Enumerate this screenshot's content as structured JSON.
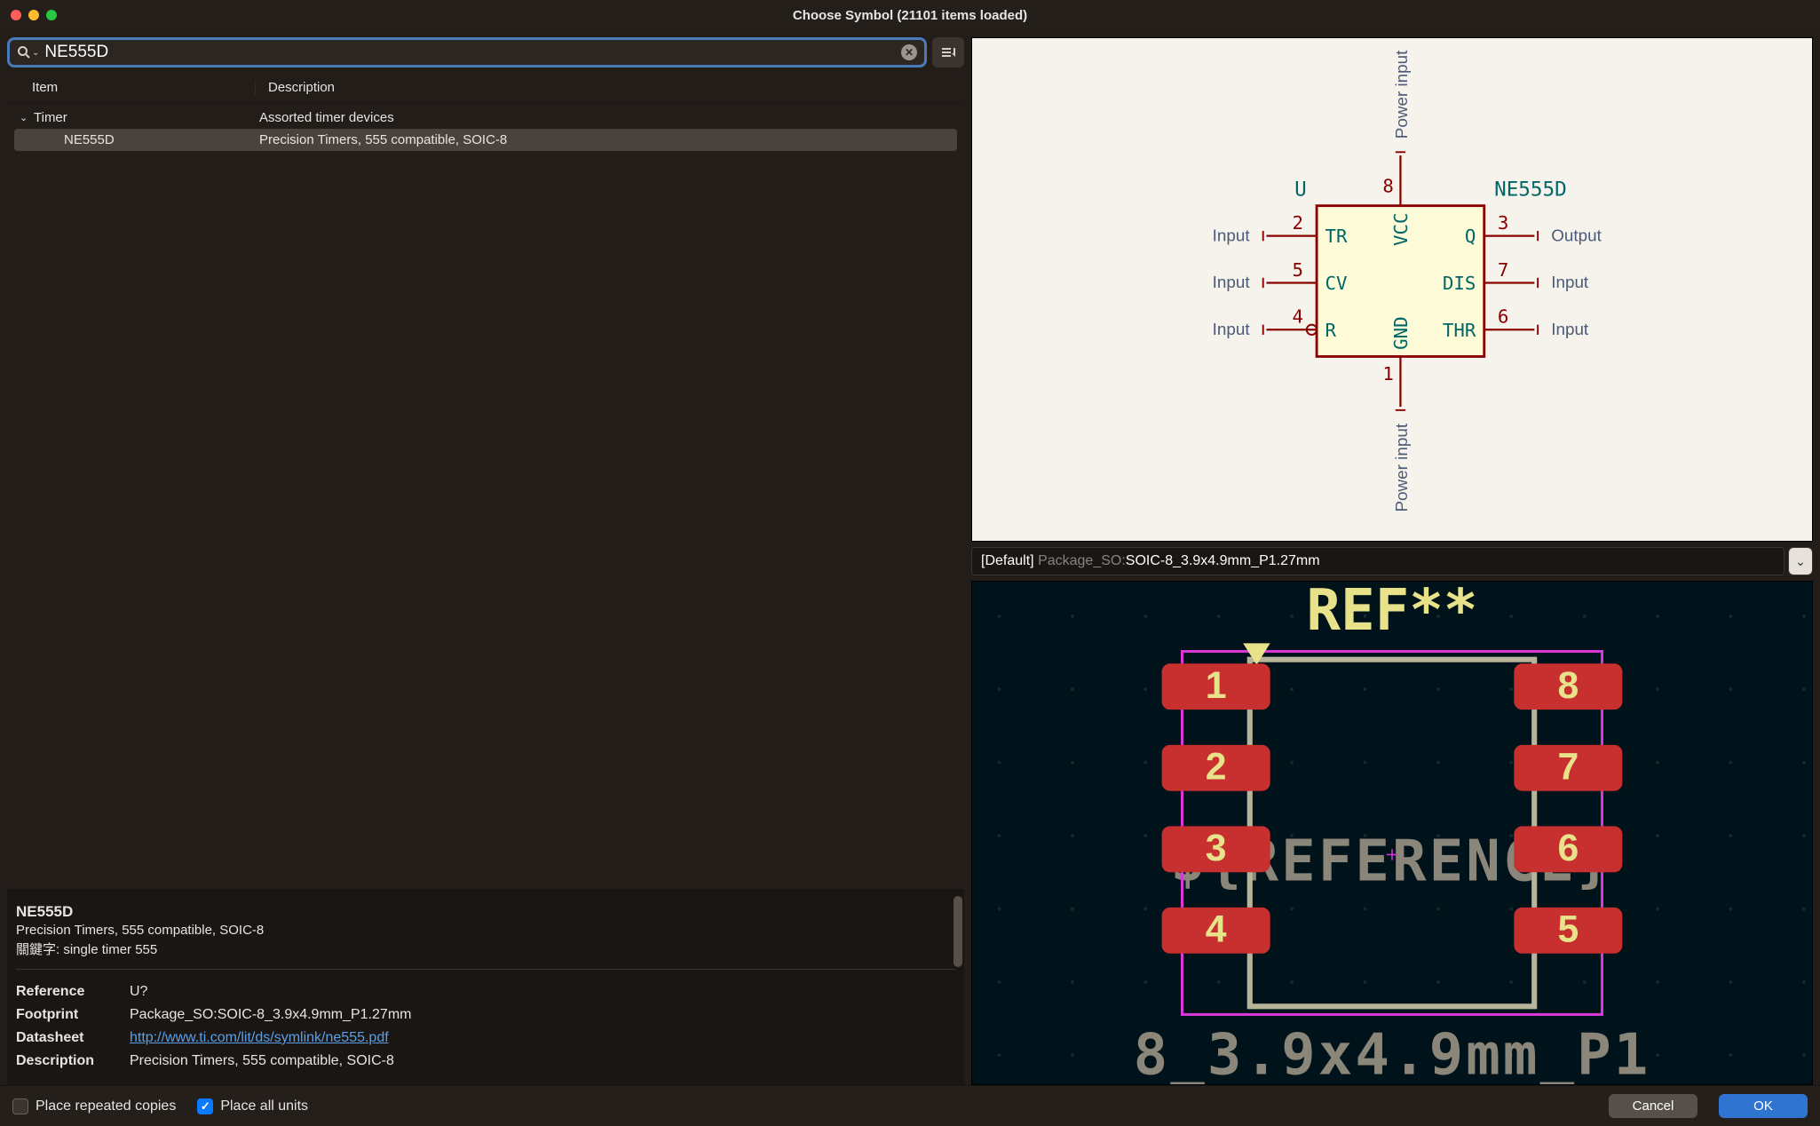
{
  "window": {
    "title": "Choose Symbol (21101 items loaded)"
  },
  "search": {
    "value": "NE555D"
  },
  "columns": {
    "item": "Item",
    "description": "Description"
  },
  "tree": {
    "category": {
      "name": "Timer",
      "desc": "Assorted timer devices"
    },
    "rows": [
      {
        "name": "NE555D",
        "desc": "Precision Timers, 555 compatible, SOIC-8",
        "selected": true
      }
    ]
  },
  "detail": {
    "title": "NE555D",
    "subtitle": "Precision Timers, 555 compatible, SOIC-8",
    "keywords_label": "關鍵字:",
    "keywords": "single timer 555",
    "props": [
      {
        "label": "Reference",
        "value": "U?"
      },
      {
        "label": "Footprint",
        "value": "Package_SO:SOIC-8_3.9x4.9mm_P1.27mm"
      },
      {
        "label": "Datasheet",
        "value": "http://www.ti.com/lit/ds/symlink/ne555.pdf",
        "link": true
      },
      {
        "label": "Description",
        "value": "Precision Timers, 555 compatible, SOIC-8"
      }
    ]
  },
  "symbol": {
    "ref": "U",
    "name": "NE555D",
    "pins": [
      {
        "num": "1",
        "name": "GND",
        "side": "bottom",
        "type": "Power input"
      },
      {
        "num": "2",
        "name": "TR",
        "side": "left",
        "type": "Input",
        "row": 0
      },
      {
        "num": "3",
        "name": "Q",
        "side": "right",
        "type": "Output",
        "row": 0
      },
      {
        "num": "4",
        "name": "R",
        "side": "left",
        "type": "Input",
        "row": 2,
        "invert": true
      },
      {
        "num": "5",
        "name": "CV",
        "side": "left",
        "type": "Input",
        "row": 1
      },
      {
        "num": "6",
        "name": "THR",
        "side": "right",
        "type": "Input",
        "row": 2
      },
      {
        "num": "7",
        "name": "DIS",
        "side": "right",
        "type": "Input",
        "row": 1
      },
      {
        "num": "8",
        "name": "VCC",
        "side": "top",
        "type": "Power input"
      }
    ]
  },
  "footprint": {
    "selector_default": "[Default]",
    "selector_lib": "Package_SO:",
    "selector_val": "SOIC-8_3.9x4.9mm_P1.27mm",
    "ref_text": "REF**",
    "value_text": "${REFERENCE}",
    "bottom_text": "8_3.9x4.9mm_P1",
    "pads": [
      1,
      2,
      3,
      4,
      5,
      6,
      7,
      8
    ]
  },
  "bottom": {
    "place_repeated": {
      "label": "Place repeated copies",
      "checked": false
    },
    "place_all_units": {
      "label": "Place all units",
      "checked": true
    },
    "cancel": "Cancel",
    "ok": "OK"
  }
}
